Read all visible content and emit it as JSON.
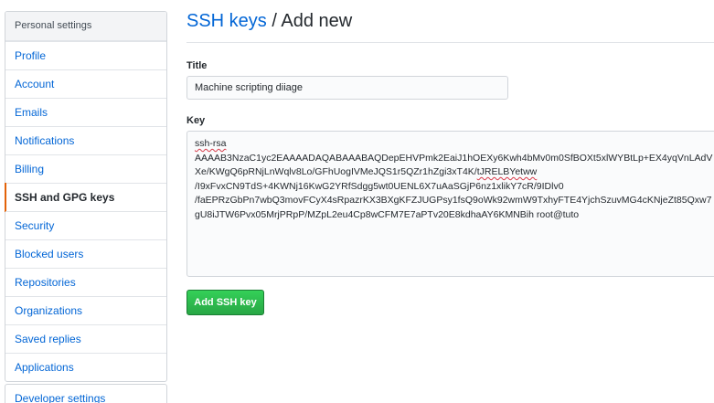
{
  "sidebar": {
    "header": "Personal settings",
    "items": [
      {
        "label": "Profile"
      },
      {
        "label": "Account"
      },
      {
        "label": "Emails"
      },
      {
        "label": "Notifications"
      },
      {
        "label": "Billing"
      },
      {
        "label": "SSH and GPG keys",
        "selected": true
      },
      {
        "label": "Security"
      },
      {
        "label": "Blocked users"
      },
      {
        "label": "Repositories"
      },
      {
        "label": "Organizations"
      },
      {
        "label": "Saved replies"
      },
      {
        "label": "Applications"
      }
    ],
    "developer_settings": "Developer settings"
  },
  "page": {
    "title_link": "SSH keys",
    "title_rest": " / Add new"
  },
  "form": {
    "title_label": "Title",
    "title_value": "Machine scripting diiage",
    "key_label": "Key",
    "key_lines": [
      [
        "ssh-rsa",
        "",
        ""
      ],
      [
        "AAAAB3NzaC1yc2EAAAADAQABAAABAQDepEHVPmk2EaiJ1hOEXy6Kwh4bMv0m0SfBOXt5xlWYBtLp+EX4yqVnLAdV",
        "",
        ""
      ],
      [
        "Xe/KWgQ6pRNjLnWqlv8Lo/GFhUogIVMeJQS1r5QZr1hZgi3xT4K/",
        "tJRELBYetww",
        ""
      ],
      [
        "/I9xFvxCN9TdS+4KWNj16KwG2YRfSdgg5wt0UENL6X7uAaSGjP6nz1xlikY7cR/9IDlv0",
        "",
        ""
      ],
      [
        "/faEPRzGbPn7wbQ3movFCyX4sRpazrKX3BXgKFZJUGPsy1fsQ9oWk92wmW9TxhyFTE4YjchSzuvMG4cKNjeZt85Qxw7",
        "",
        ""
      ],
      [
        "gU8iJTW6Pvx05MrjPRpP/MZpL2eu4Cp8wCFM7E7aPTv20E8kdhaAY6KMNBih root@tuto",
        "",
        ""
      ]
    ],
    "submit_label": "Add SSH key"
  },
  "colors": {
    "link": "#0366d6",
    "selected_indicator": "#e36209",
    "primary_button": "#28a745"
  }
}
